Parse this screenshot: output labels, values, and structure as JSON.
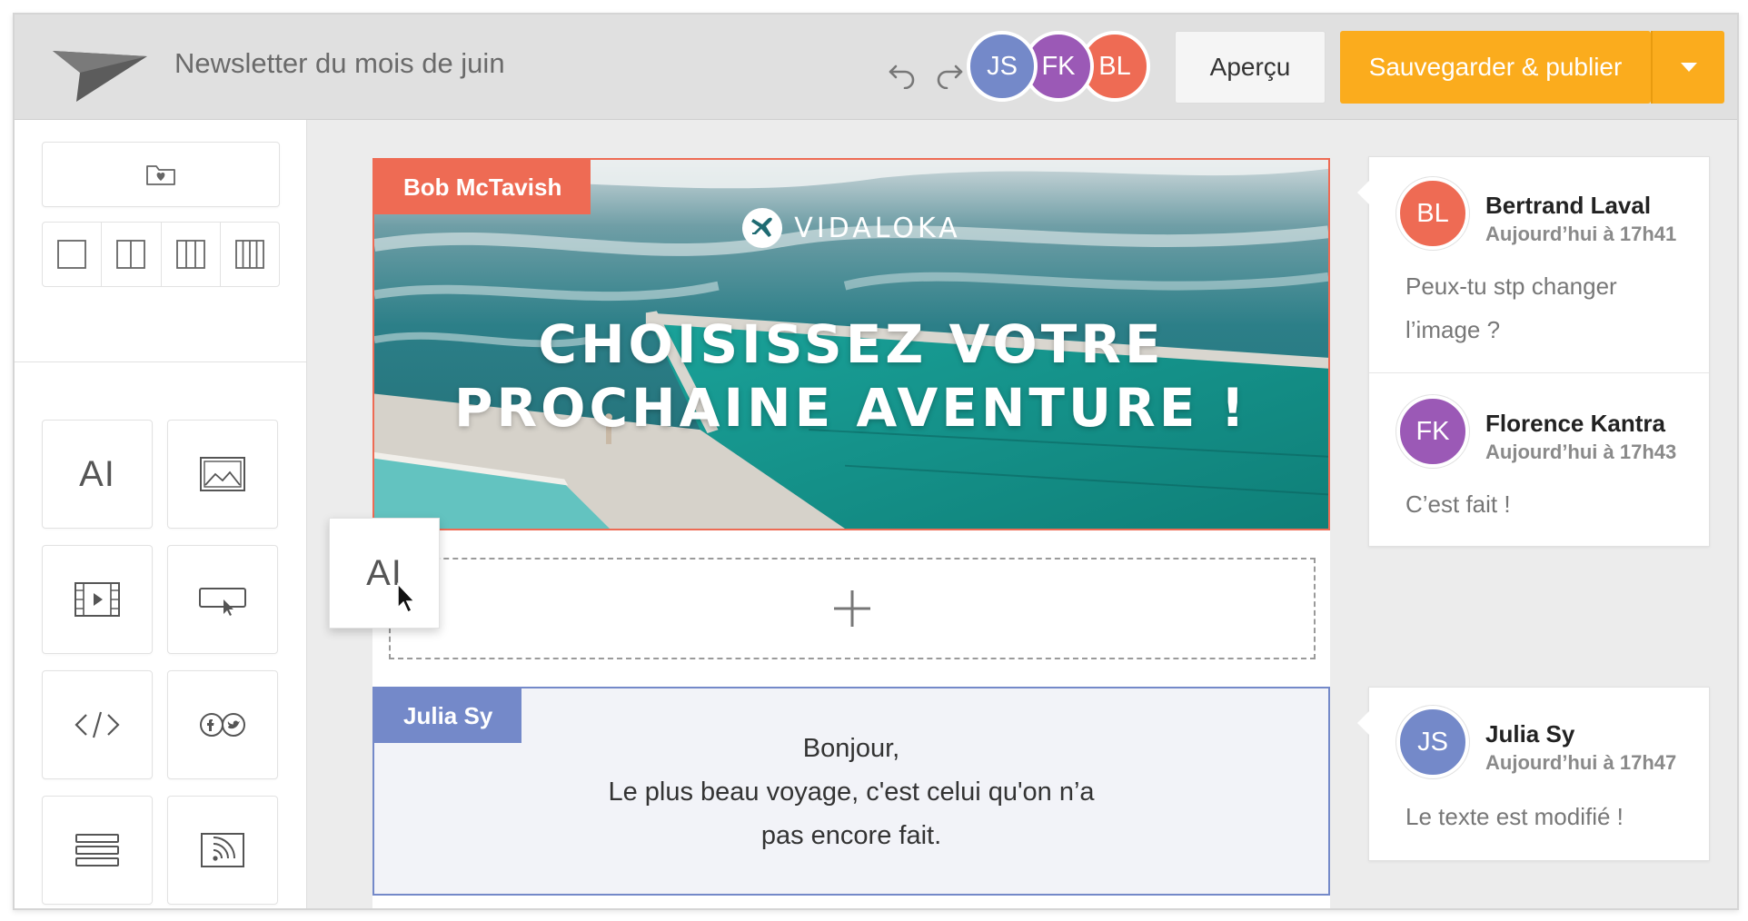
{
  "header": {
    "title": "Newsletter du mois de juin",
    "collaborators": [
      {
        "initials": "JS",
        "color": "#7489c9"
      },
      {
        "initials": "FK",
        "color": "#9b59b6"
      },
      {
        "initials": "BL",
        "color": "#ee6b54"
      }
    ],
    "preview_label": "Aperçu",
    "publish_label": "Sauvegarder & publier"
  },
  "sidebar": {
    "layout_options": [
      "1-column",
      "2-columns",
      "3-columns",
      "4-columns"
    ],
    "blocks": [
      {
        "name": "text-block-tile",
        "glyph": "AI"
      },
      {
        "name": "image-block-tile",
        "icon": "image-icon"
      },
      {
        "name": "video-block-tile",
        "icon": "video-icon"
      },
      {
        "name": "button-block-tile",
        "icon": "button-icon"
      },
      {
        "name": "html-block-tile",
        "icon": "code-icon"
      },
      {
        "name": "social-block-tile",
        "icon": "social-icon"
      },
      {
        "name": "divider-block-tile",
        "icon": "divider-icon"
      },
      {
        "name": "rss-block-tile",
        "icon": "rss-icon"
      }
    ]
  },
  "canvas": {
    "hero": {
      "editor_tag": "Bob McTavish",
      "brand": "VIDALOKA",
      "headline_line1": "CHOISISSEZ VOTRE",
      "headline_line2": "PROCHAINE AVENTURE !"
    },
    "dragging_glyph": "AI",
    "text_block": {
      "editor_tag": "Julia Sy",
      "line1": "Bonjour,",
      "line2": "Le plus beau voyage, c'est celui qu'on n’a",
      "line3": "pas encore fait."
    }
  },
  "comments": [
    {
      "thread": [
        {
          "initials": "BL",
          "color": "#ee6b54",
          "name": "Bertrand Laval",
          "time": "Aujourd’hui à 17h41",
          "text": "Peux-tu stp changer l’image ?"
        },
        {
          "initials": "FK",
          "color": "#9b59b6",
          "name": "Florence Kantra",
          "time": "Aujourd’hui à 17h43",
          "text": "C’est fait !"
        }
      ]
    },
    {
      "thread": [
        {
          "initials": "JS",
          "color": "#7489c9",
          "name": "Julia Sy",
          "time": "Aujourd’hui à 17h47",
          "text": "Le texte est modifié !"
        }
      ]
    }
  ],
  "colors": {
    "accent_orange": "#fbac1d",
    "editor_red": "#ee6b54",
    "editor_blue": "#7489c9"
  }
}
